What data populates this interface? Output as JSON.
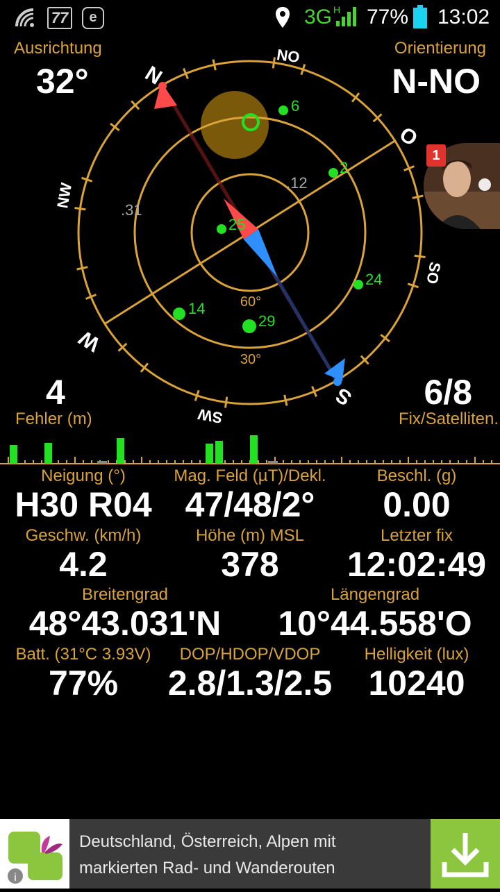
{
  "status_bar": {
    "badge_number": "77",
    "network": "3G",
    "network_sup": "H",
    "battery": "77%",
    "time": "13:02",
    "colors": {
      "network": "#4cd137",
      "battery": "#19d3f0"
    }
  },
  "top_left": {
    "label": "Ausrichtung",
    "value": "32°"
  },
  "top_right": {
    "label": "Orientierung",
    "value": "N-NO"
  },
  "bottom_left": {
    "label": "Fehler (m)",
    "value": "4"
  },
  "bottom_right": {
    "label": "Fix/Satelliten.",
    "value": "6/8"
  },
  "compass": {
    "directions": {
      "n": "N",
      "no": "NO",
      "o": "O",
      "so": "SO",
      "s": "S",
      "sw": "SW",
      "w": "W",
      "nw": "NW"
    },
    "ring_labels": {
      "r60": "60°",
      "r30": "30°"
    },
    "satellites_used": [
      "6",
      "2",
      "25",
      "24",
      "14",
      "29"
    ],
    "satellites_unused": [
      ".12",
      ".31"
    ],
    "colors": {
      "ring": "#d9a33a",
      "sat": "#22e022",
      "north": "#ff4a4a",
      "south": "#2f8fff"
    }
  },
  "notification": {
    "count": "1"
  },
  "signal_bars": [
    {
      "level": 0.45,
      "used": true
    },
    {
      "level": 0.5,
      "used": true
    },
    {
      "level": 0.62,
      "used": true
    },
    {
      "level": 0.48,
      "used": true
    },
    {
      "level": 0.55,
      "used": true
    },
    {
      "level": 0.68,
      "used": true
    }
  ],
  "grid": {
    "neigung": {
      "label": "Neigung (°)",
      "value": "H30 R04"
    },
    "mag": {
      "label": "Mag. Feld (µT)/Dekl.",
      "value": "47/48/2°"
    },
    "beschl": {
      "label": "Beschl. (g)",
      "value": "0.00"
    },
    "geschw": {
      "label": "Geschw. (km/h)",
      "value": "4.2"
    },
    "hoehe": {
      "label": "Höhe (m) MSL",
      "value": "378"
    },
    "fix": {
      "label": "Letzter fix",
      "value": "12:02:49"
    },
    "breite": {
      "label": "Breitengrad",
      "value": "48°43.031'N"
    },
    "laenge": {
      "label": "Längengrad",
      "value": "10°44.558'O"
    },
    "batt": {
      "label": "Batt. (31°C 3.93V)",
      "value": "77%"
    },
    "dop": {
      "label": "DOP/HDOP/VDOP",
      "value": "2.8/1.3/2.5"
    },
    "hell": {
      "label": "Helligkeit (lux)",
      "value": "10240"
    }
  },
  "ad": {
    "line1": "Deutschland, Österreich, Alpen mit",
    "line2": "markierten Rad- und Wanderouten"
  }
}
